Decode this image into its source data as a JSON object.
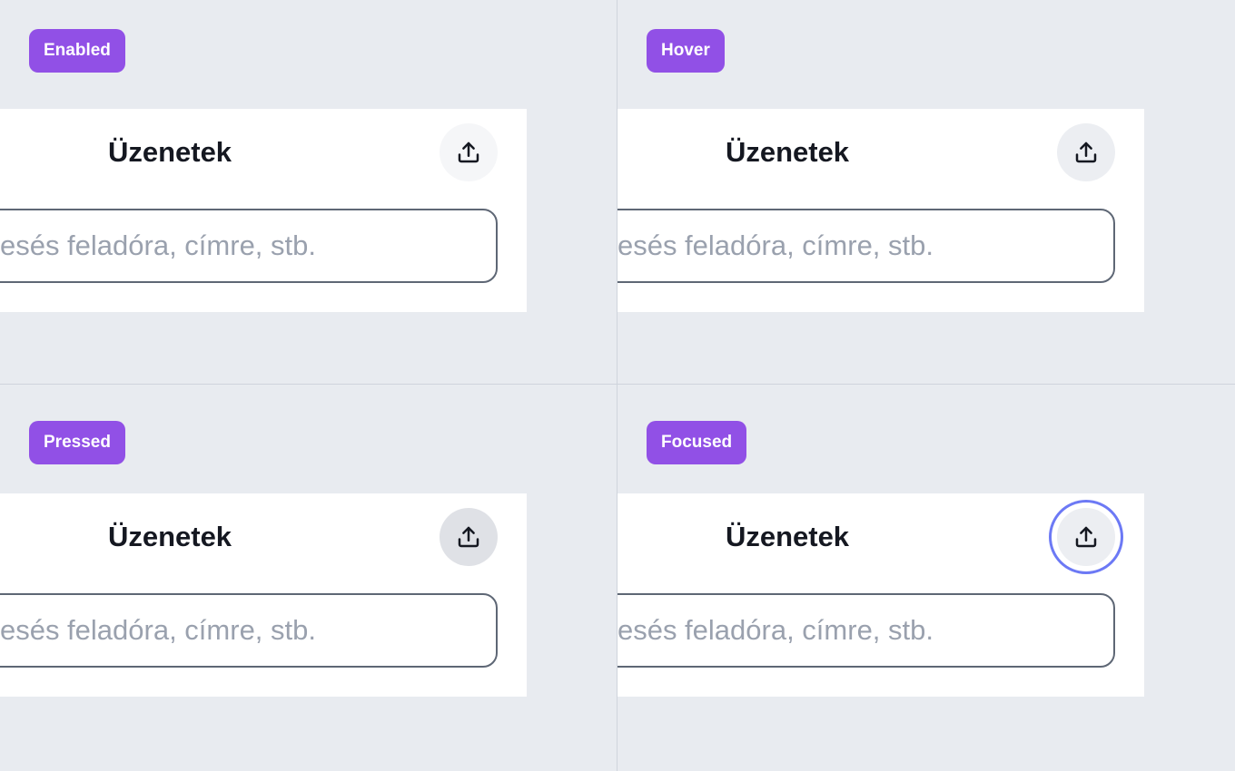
{
  "states": [
    {
      "badge": "Enabled",
      "title": "Üzenetek",
      "search_placeholder": "Keresés feladóra, címre, stb.",
      "button_icon": "share-upload-icon"
    },
    {
      "badge": "Hover",
      "title": "Üzenetek",
      "search_placeholder": "Keresés feladóra, címre, stb.",
      "button_icon": "share-upload-icon"
    },
    {
      "badge": "Pressed",
      "title": "Üzenetek",
      "search_placeholder": "Keresés feladóra, címre, stb.",
      "button_icon": "share-upload-icon"
    },
    {
      "badge": "Focused",
      "title": "Üzenetek",
      "search_placeholder": "Keresés feladóra, címre, stb.",
      "button_icon": "share-upload-icon"
    }
  ],
  "colors": {
    "badge_bg": "#9150e6",
    "background": "#e8ebf0",
    "focus_ring": "#6c79f5",
    "title_text": "#151821",
    "placeholder_text": "#9aa1ae"
  }
}
